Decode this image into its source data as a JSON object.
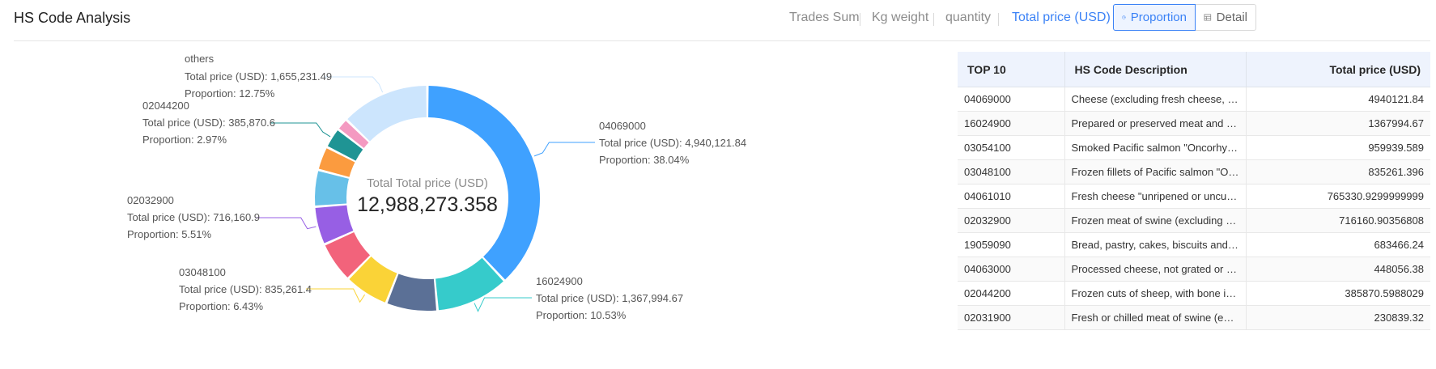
{
  "header": {
    "title": "HS Code Analysis",
    "metric_tabs": [
      {
        "label": "Trades Sum",
        "active": false
      },
      {
        "label": "Kg weight",
        "active": false
      },
      {
        "label": "quantity",
        "active": false
      },
      {
        "label": "Total price (USD)",
        "active": true
      }
    ],
    "view_toggle": [
      {
        "label": "Proportion",
        "icon": "pie-chart-icon",
        "active": true
      },
      {
        "label": "Detail",
        "icon": "table-icon",
        "active": false
      }
    ]
  },
  "colors": {
    "accent": "#3b82f6",
    "series": [
      "#3fa1ff",
      "#36cbcb",
      "#5b7096",
      "#fad337",
      "#f2637b",
      "#975fe4",
      "#67c0e8",
      "#fb9b3f",
      "#1f9494",
      "#f49ac1",
      "#cce5fd"
    ]
  },
  "chart_data": {
    "type": "pie",
    "center_label": "Total Total price (USD)",
    "center_value": "12,988,273.358",
    "slices": [
      {
        "code": "04069000",
        "value": 4940121.84,
        "proportion": 38.04
      },
      {
        "code": "16024900",
        "value": 1367994.67,
        "proportion": 10.53
      },
      {
        "code": "03054100",
        "value": 959939.589,
        "proportion": 7.39
      },
      {
        "code": "03048100",
        "value": 835261.4,
        "proportion": 6.43
      },
      {
        "code": "04061010",
        "value": 765330.93,
        "proportion": 5.89
      },
      {
        "code": "02032900",
        "value": 716160.9,
        "proportion": 5.51
      },
      {
        "code": "19059090",
        "value": 683466.24,
        "proportion": 5.26
      },
      {
        "code": "04063000",
        "value": 448056.38,
        "proportion": 3.45
      },
      {
        "code": "02044200",
        "value": 385870.6,
        "proportion": 2.97
      },
      {
        "code": "02031900",
        "value": 230839.32,
        "proportion": 1.78
      },
      {
        "code": "others",
        "value": 1655231.49,
        "proportion": 12.75
      }
    ],
    "callouts": [
      {
        "code": "04069000",
        "value_text": "Total price (USD): 4,940,121.84",
        "proportion_text": "Proportion: 38.04%"
      },
      {
        "code": "16024900",
        "value_text": "Total price (USD): 1,367,994.67",
        "proportion_text": "Proportion: 10.53%"
      },
      {
        "code": "03048100",
        "value_text": "Total price (USD): 835,261.4",
        "proportion_text": "Proportion: 6.43%"
      },
      {
        "code": "02032900",
        "value_text": "Total price (USD): 716,160.9",
        "proportion_text": "Proportion: 5.51%"
      },
      {
        "code": "02044200",
        "value_text": "Total price (USD): 385,870.6",
        "proportion_text": "Proportion: 2.97%"
      },
      {
        "code": "others",
        "value_text": "Total price (USD): 1,655,231.49",
        "proportion_text": "Proportion: 12.75%"
      }
    ]
  },
  "table": {
    "headers": [
      "TOP 10",
      "HS Code Description",
      "Total price (USD)"
    ],
    "rows": [
      [
        "04069000",
        "Cheese (excluding fresh cheese, incl. ...",
        "4940121.84"
      ],
      [
        "16024900",
        "Prepared or preserved meat and offal ...",
        "1367994.67"
      ],
      [
        "03054100",
        "Smoked Pacific salmon \"Oncorhynchus...",
        "959939.589"
      ],
      [
        "03048100",
        "Frozen fillets of Pacific salmon \"Oncor...",
        "835261.396"
      ],
      [
        "04061010",
        "Fresh cheese \"unripened or uncured c...",
        "765330.9299999999"
      ],
      [
        "02032900",
        "Frozen meat of swine (excluding carca...",
        "716160.90356808"
      ],
      [
        "19059090",
        "Bread, pastry, cakes, biscuits and othe...",
        "683466.24"
      ],
      [
        "04063000",
        "Processed cheese, not grated or powd...",
        "448056.38"
      ],
      [
        "02044200",
        "Frozen cuts of sheep, with bone in (ex...",
        "385870.5988029"
      ],
      [
        "02031900",
        "Fresh or chilled meat of swine (excludi...",
        "230839.32"
      ]
    ]
  }
}
